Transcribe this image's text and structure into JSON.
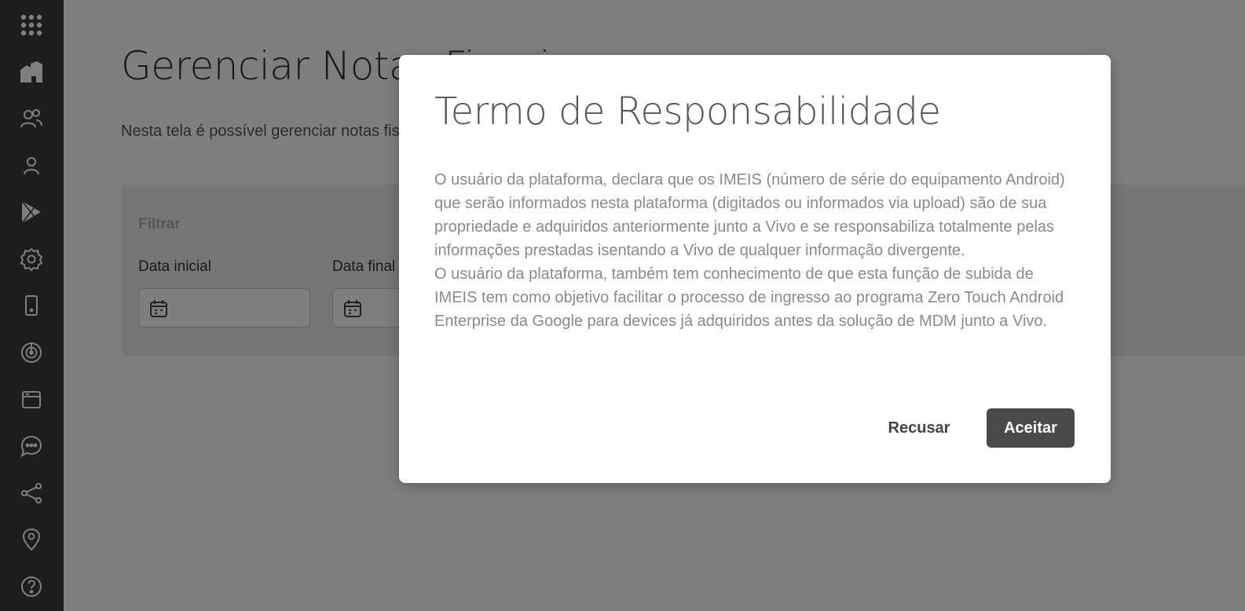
{
  "sidebar": {
    "items": [
      {
        "icon": "apps-grid-icon"
      },
      {
        "icon": "buildings-icon"
      },
      {
        "icon": "users-group-icon"
      },
      {
        "icon": "user-icon"
      },
      {
        "icon": "google-play-icon"
      },
      {
        "icon": "gear-icon"
      },
      {
        "icon": "mobile-device-icon"
      },
      {
        "icon": "radar-icon"
      },
      {
        "icon": "browser-window-icon"
      },
      {
        "icon": "chat-bubble-icon"
      },
      {
        "icon": "share-nodes-icon"
      },
      {
        "icon": "location-pin-icon"
      },
      {
        "icon": "help-circle-icon"
      }
    ]
  },
  "main": {
    "title": "Gerenciar Notas Fiscais",
    "description": "Nesta tela é possível gerenciar notas fiscais",
    "filter": {
      "title": "Filtrar",
      "start_date_label": "Data inicial",
      "end_date_label": "Data final"
    }
  },
  "modal": {
    "title": "Termo de Responsabilidade",
    "paragraph1": "O usuário da plataforma, declara que os IMEIS (número de série do equipamento Android) que serão informados nesta plataforma (digitados ou informados via upload) são de sua propriedade e adquiridos anteriormente junto a Vivo e se responsabiliza totalmente pelas informações prestadas isentando a Vivo de qualquer informação divergente.",
    "paragraph2": "O usuário da plataforma, também tem conhecimento de que esta função de subida de IMEIS tem como objetivo facilitar o processo de ingresso ao programa Zero Touch Android Enterprise da Google para devices já adquiridos antes da solução de MDM junto a Vivo.",
    "decline_label": "Recusar",
    "accept_label": "Aceitar"
  }
}
